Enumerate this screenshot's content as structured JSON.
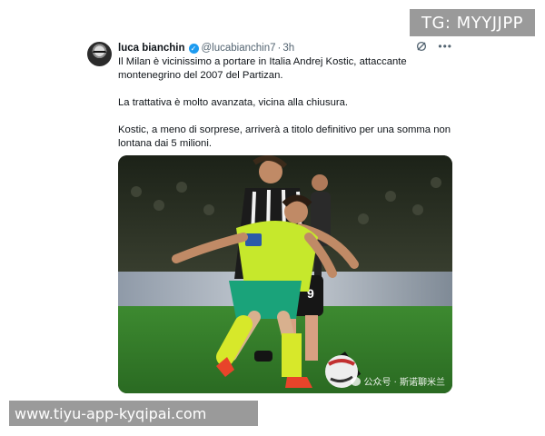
{
  "overlay": {
    "telegram_tag": "TG: MYYJJPP",
    "site_url": "www.tiyu-app-kyqipai.com"
  },
  "tweet": {
    "author_name": "luca bianchin",
    "verified": true,
    "handle": "@lucabianchin7",
    "separator": "·",
    "time": "3h",
    "paragraphs": [
      "Il Milan è vicinissimo a portare in Italia Andrej Kostic, attaccante montenegrino del 2007 del Partizan.",
      "La trattativa è molto avanzata, vicina alla chiusura.",
      "Kostic, a meno di sorprese, arriverà a titolo definitivo per una somma non lontana dai 5 milioni."
    ],
    "icons": [
      "grok-icon",
      "more-icon"
    ]
  },
  "photo": {
    "alt_subject": "two footballers contesting the ball",
    "watermark": "公众号 · 斯诺聊米兰",
    "colors": {
      "milan_kit": "#c6e82c",
      "milan_shorts": "#1aa37a",
      "partizan_kit": "#1b1b1b",
      "pitch": "#2f7a2a"
    }
  }
}
